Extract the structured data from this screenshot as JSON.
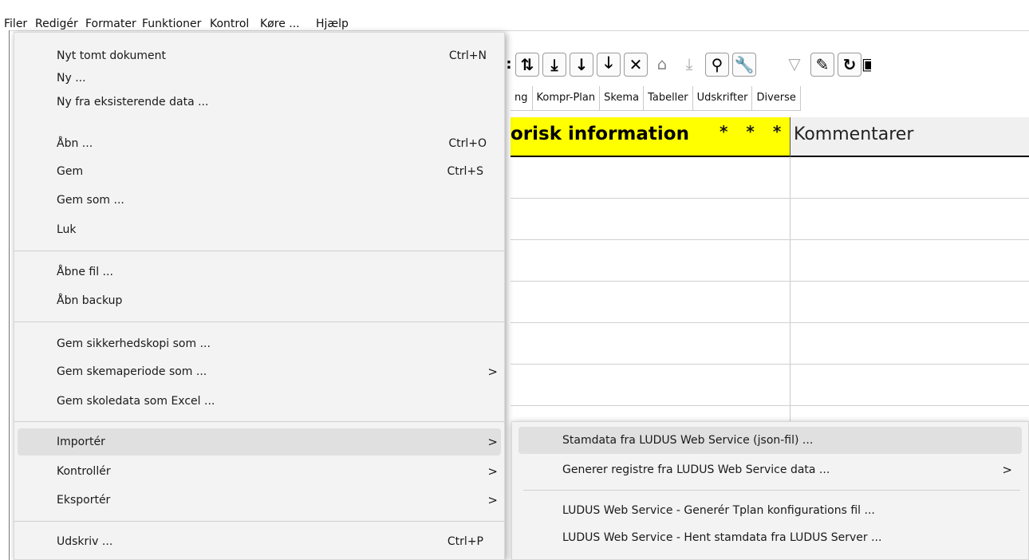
{
  "menubar": [
    "Filer",
    "Redigér",
    "Formater",
    "Funktioner",
    "Kontrol",
    "Køre ...",
    "Hjælp"
  ],
  "tabs": [
    "ng",
    "Kompr-Plan",
    "Skema",
    "Tabeller",
    "Udskrifter",
    "Diverse"
  ],
  "grid": {
    "header_main": "orisk information",
    "header_stars": "* * *",
    "header_comments": "Kommentarer"
  },
  "filer_menu": {
    "items": [
      {
        "label": "Nyt tomt dokument",
        "shortcut": "Ctrl+N"
      },
      {
        "label": "Ny ...",
        "shortcut": ""
      },
      {
        "label": "Ny fra eksisterende data ...",
        "shortcut": ""
      },
      {
        "label": "Åbn ...",
        "shortcut": "Ctrl+O"
      },
      {
        "label": "Gem",
        "shortcut": "Ctrl+S"
      },
      {
        "label": "Gem som ...",
        "shortcut": ""
      },
      {
        "label": "Luk",
        "shortcut": ""
      },
      {
        "label": "Åbne fil ...",
        "shortcut": ""
      },
      {
        "label": "Åbn backup",
        "shortcut": ""
      },
      {
        "label": "Gem sikkerhedskopi som ...",
        "shortcut": ""
      },
      {
        "label": "Gem skemaperiode som ...",
        "shortcut": "",
        "arrow": ">"
      },
      {
        "label": "Gem skoledata som Excel ...",
        "shortcut": ""
      },
      {
        "label": "Importér",
        "shortcut": "",
        "arrow": ">"
      },
      {
        "label": "Kontrollér",
        "shortcut": "",
        "arrow": ">"
      },
      {
        "label": "Eksportér",
        "shortcut": "",
        "arrow": ">"
      },
      {
        "label": "Udskriv ...",
        "shortcut": "Ctrl+P"
      }
    ]
  },
  "import_submenu": {
    "items": [
      {
        "label": "Stamdata fra LUDUS Web Service (json-fil) ..."
      },
      {
        "label": "Generer registre fra LUDUS Web Service data ...",
        "arrow": ">"
      },
      {
        "label": "LUDUS Web Service - Generér Tplan konfigurations fil ..."
      },
      {
        "label": "LUDUS Web Service - Hent stamdata fra LUDUS Server ..."
      }
    ]
  }
}
